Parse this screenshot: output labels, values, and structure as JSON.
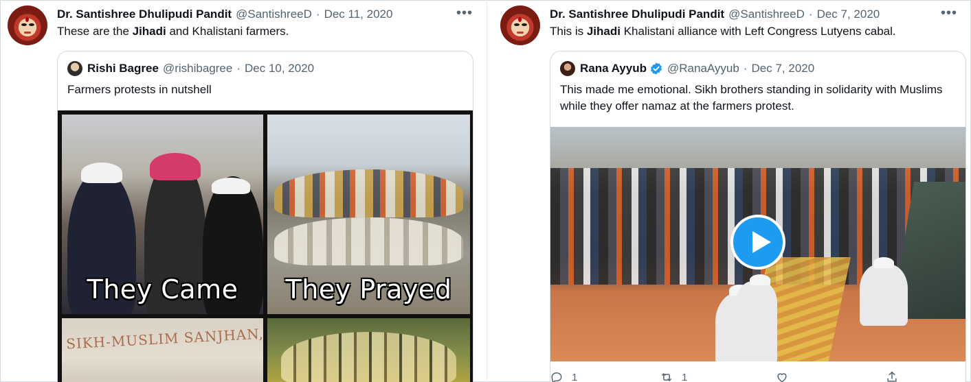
{
  "tweets": [
    {
      "author": {
        "name": "Dr. Santishree Dhulipudi Pandit",
        "handle": "@SantishreeD"
      },
      "separator": "·",
      "date": "Dec 11, 2020",
      "more_icon": "more-horizontal-icon",
      "text_pre": "These are the ",
      "text_bold": "Jihadi",
      "text_post": " and Khalistani farmers.",
      "quoted": {
        "author": {
          "name": "Rishi Bagree",
          "handle": "@rishibagree"
        },
        "separator": "·",
        "date": "Dec 10, 2020",
        "text": "Farmers protests in nutshell",
        "media": {
          "type": "image-collage",
          "captions": [
            "They Came",
            "They Prayed"
          ],
          "banner_text": "SIKH-MUSLIM SANJHAN,"
        }
      }
    },
    {
      "author": {
        "name": "Dr. Santishree Dhulipudi Pandit",
        "handle": "@SantishreeD"
      },
      "separator": "·",
      "date": "Dec 7, 2020",
      "more_icon": "more-horizontal-icon",
      "text_pre": "This is ",
      "text_bold": "Jihadi",
      "text_post": " Khalistani alliance with Left Congress Lutyens cabal.",
      "quoted": {
        "author": {
          "name": "Rana Ayyub",
          "handle": "@RanaAyyub",
          "verified": true
        },
        "separator": "·",
        "date": "Dec 7, 2020",
        "text": "This made me emotional. Sikh brothers standing in solidarity with Muslims while they offer namaz at the farmers protest.",
        "media": {
          "type": "video",
          "play_icon": "play-icon"
        }
      },
      "actions": {
        "reply_count": "1",
        "retweet_count": "1"
      }
    }
  ],
  "colors": {
    "accent": "#1d9bf0",
    "text_primary": "#0f1419",
    "text_secondary": "#536471",
    "border": "#cfd9de"
  }
}
